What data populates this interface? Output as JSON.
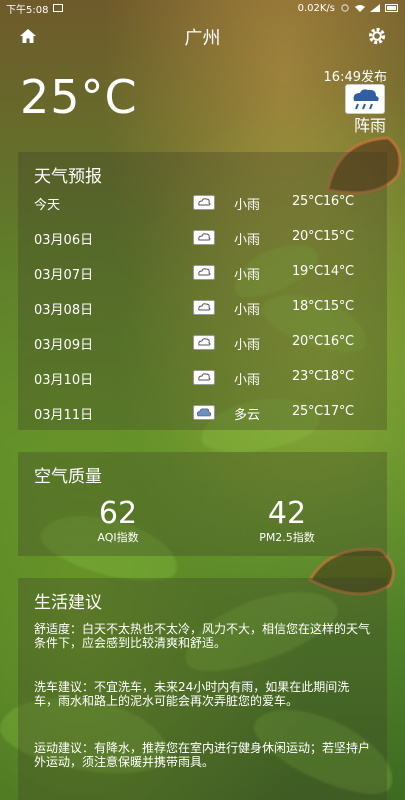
{
  "status_bar": {
    "time": "下午5:08",
    "network_speed": "0.02K/s"
  },
  "header": {
    "city": "广州",
    "home_icon": "home-icon",
    "settings_icon": "gear-icon"
  },
  "current": {
    "temperature": "25°C",
    "publish_time": "16:49发布",
    "condition_icon": "rain-cloud-icon",
    "condition": "阵雨"
  },
  "forecast": {
    "title": "天气预报",
    "rows": [
      {
        "date": "今天",
        "icon": "cloud-rain-icon",
        "condition": "小雨",
        "temp": "25°C16°C"
      },
      {
        "date": "03月06日",
        "icon": "cloud-rain-icon",
        "condition": "小雨",
        "temp": "20°C15°C"
      },
      {
        "date": "03月07日",
        "icon": "cloud-rain-icon",
        "condition": "小雨",
        "temp": "19°C14°C"
      },
      {
        "date": "03月08日",
        "icon": "cloud-rain-icon",
        "condition": "小雨",
        "temp": "18°C15°C"
      },
      {
        "date": "03月09日",
        "icon": "cloud-rain-icon",
        "condition": "小雨",
        "temp": "20°C16°C"
      },
      {
        "date": "03月10日",
        "icon": "cloud-rain-icon",
        "condition": "小雨",
        "temp": "23°C18°C"
      },
      {
        "date": "03月11日",
        "icon": "cloud-icon",
        "condition": "多云",
        "temp": "25°C17°C"
      }
    ]
  },
  "air_quality": {
    "title": "空气质量",
    "aqi_value": "62",
    "aqi_label": "AQI指数",
    "pm25_value": "42",
    "pm25_label": "PM2.5指数"
  },
  "suggestions": {
    "title": "生活建议",
    "comfort": "舒适度：白天不太热也不太冷，风力不大，相信您在这样的天气条件下，应会感到比较清爽和舒适。",
    "car_wash": "洗车建议：不宜洗车，未来24小时内有雨，如果在此期间洗车，雨水和路上的泥水可能会再次弄脏您的爱车。",
    "sport": "运动建议：有降水，推荐您在室内进行健身休闲运动；若坚持户外运动，须注意保暖并携带雨具。"
  }
}
